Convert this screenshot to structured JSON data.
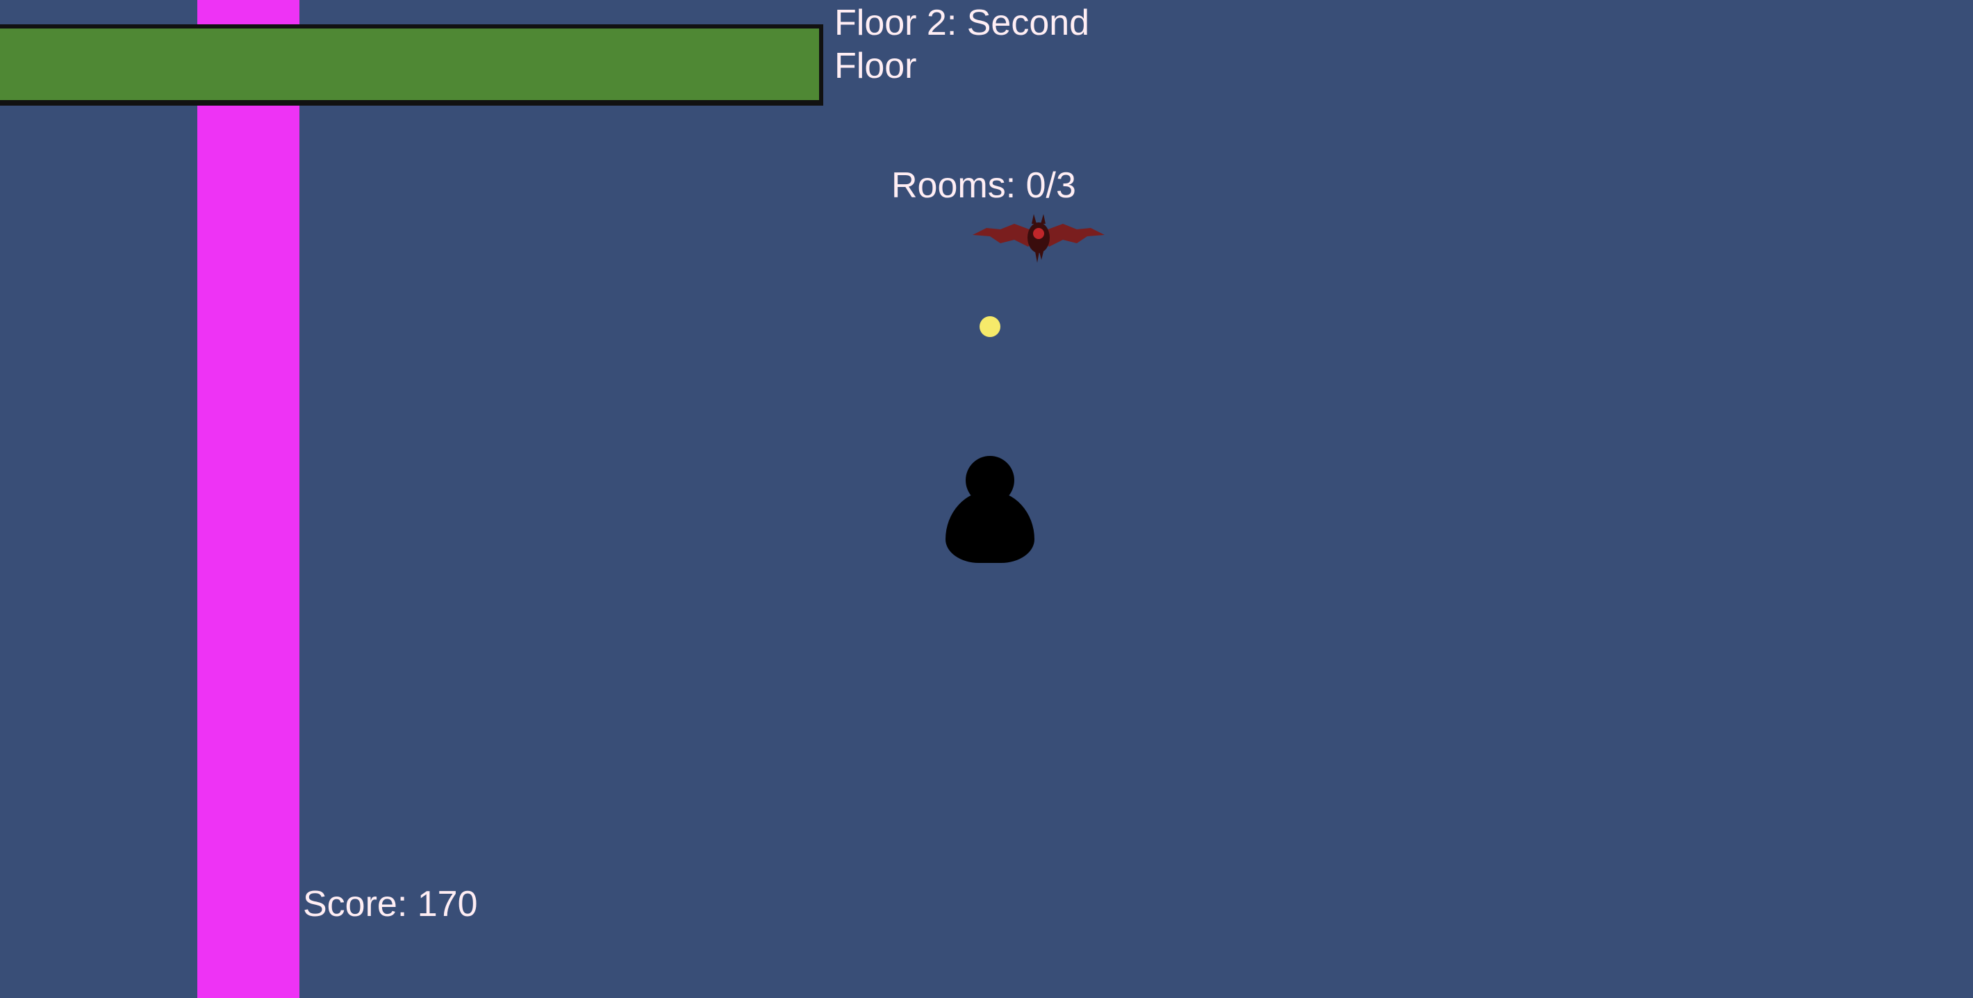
{
  "hud": {
    "floor_label": "Floor 2: Second Floor",
    "rooms_label": "Rooms: 0/3",
    "score_label": "Score: 170",
    "health_fraction": 1.0
  },
  "scene": {
    "entities": [
      {
        "name": "bat-enemy",
        "icon": "bat-icon"
      },
      {
        "name": "collectible-orb",
        "icon": "orb-icon"
      },
      {
        "name": "player",
        "icon": "player-silhouette-icon"
      }
    ]
  },
  "colors": {
    "background": "#394e77",
    "wall": "#ee33f5",
    "health_fill": "#4f8834",
    "health_border": "#111111",
    "hud_text": "#ffeef4",
    "orb": "#f6ea6a",
    "player": "#000000",
    "bat_wing": "#7a1e1e",
    "bat_body": "#3a0d0d",
    "bat_eye": "#c0262a"
  }
}
